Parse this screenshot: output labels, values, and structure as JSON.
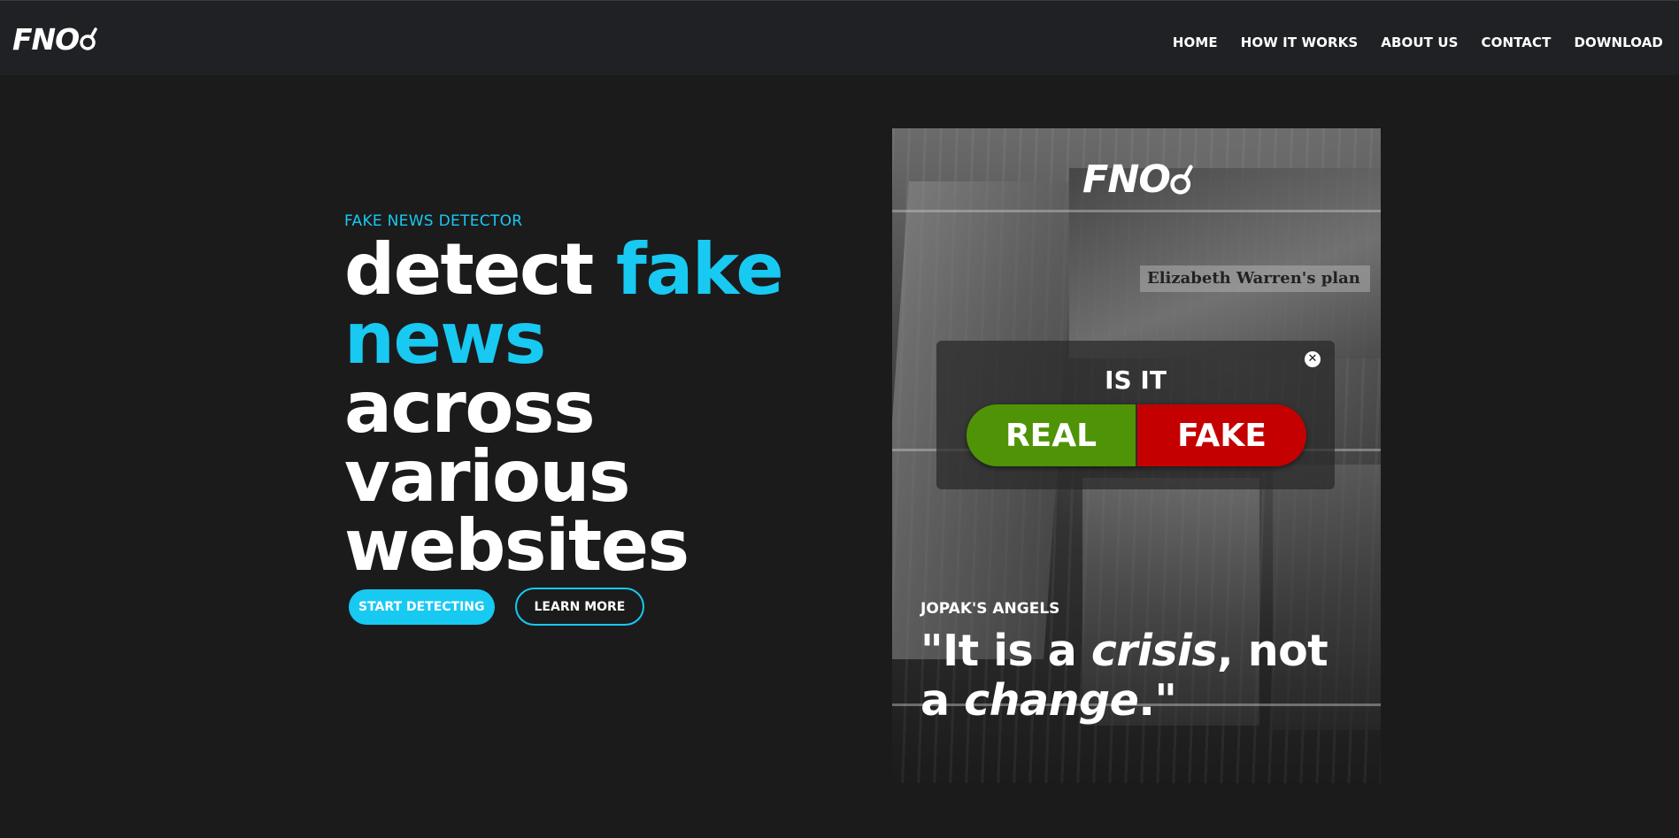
{
  "brand": {
    "logo_text": "FNO"
  },
  "nav": {
    "items": [
      {
        "label": "HOME"
      },
      {
        "label": "HOW IT WORKS"
      },
      {
        "label": "ABOUT US"
      },
      {
        "label": "CONTACT"
      },
      {
        "label": "DOWNLOAD"
      }
    ]
  },
  "hero": {
    "eyebrow": "FAKE NEWS DETECTOR",
    "headline": {
      "part1": "detect ",
      "part2": "fake",
      "part3": "news",
      "part4": "across",
      "part5": "various",
      "part6": "websites"
    },
    "primary_button": "START DETECTING",
    "secondary_button": "LEARN MORE"
  },
  "card": {
    "logo_text": "FNO",
    "image_headline": "Elizabeth Warren's plan",
    "popup": {
      "title": "IS IT",
      "real_label": "REAL",
      "fake_label": "FAKE",
      "close_symbol": "✕"
    },
    "quote": {
      "author": "JOPAK'S ANGELS",
      "open": "\"It is a ",
      "emph1": "crisis",
      "mid": ", not a ",
      "emph2": "change",
      "close": ".\""
    }
  },
  "colors": {
    "accent": "#18c9f2",
    "background": "#1b1b1c",
    "topbar": "#202124",
    "real": "#4f9306",
    "fake": "#c40000"
  }
}
